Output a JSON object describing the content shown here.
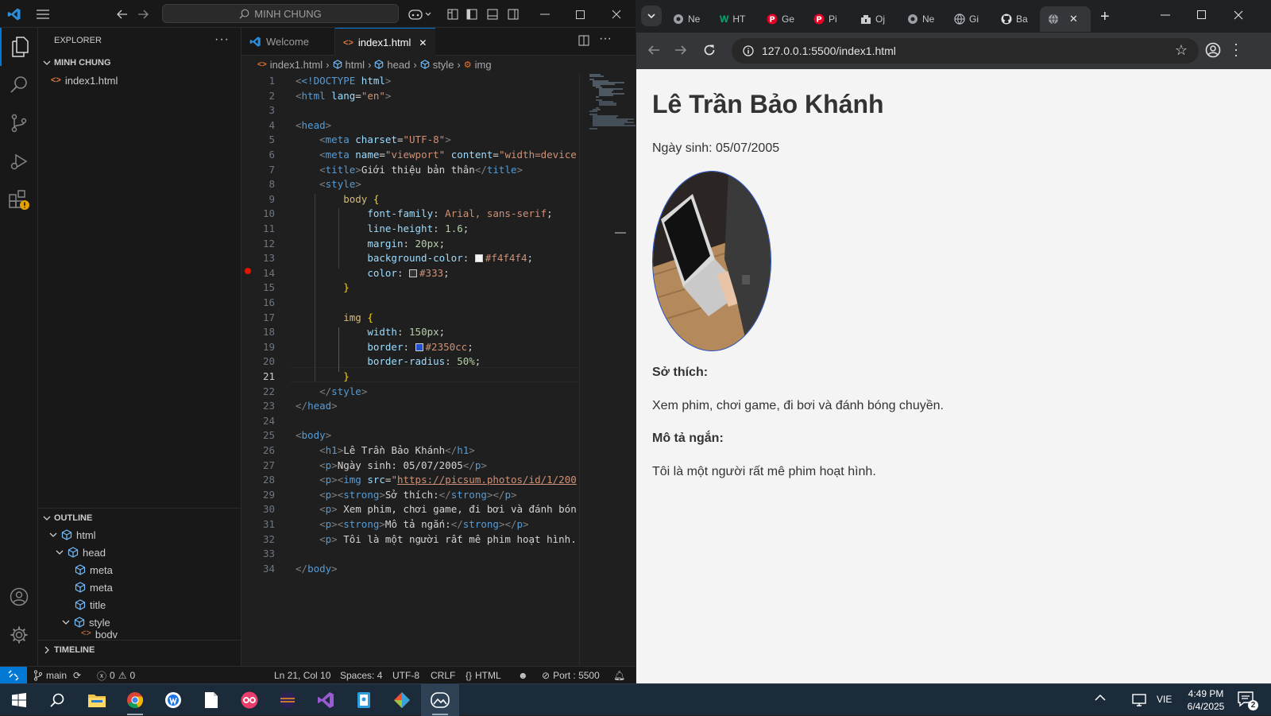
{
  "vscode": {
    "search_text": "MINH CHUNG",
    "explorer_title": "EXPLORER",
    "folder_name": "MINH CHUNG",
    "file_name": "index1.html",
    "outline_title": "OUTLINE",
    "outline_items": [
      "html",
      "head",
      "meta",
      "meta",
      "title",
      "style",
      "body"
    ],
    "timeline_title": "TIMELINE",
    "tabs": [
      {
        "label": "Welcome"
      },
      {
        "label": "index1.html",
        "close": "✕"
      }
    ],
    "breadcrumb": [
      "index1.html",
      "html",
      "head",
      "style",
      "img"
    ],
    "line_numbers": [
      "1",
      "2",
      "3",
      "4",
      "5",
      "6",
      "7",
      "8",
      "9",
      "10",
      "11",
      "12",
      "13",
      "14",
      "15",
      "16",
      "17",
      "18",
      "19",
      "20",
      "21",
      "22",
      "23",
      "24",
      "25",
      "26",
      "27",
      "28",
      "29",
      "30",
      "31",
      "32",
      "33",
      "34"
    ],
    "code": {
      "l1a": "<!DOCTYPE",
      "l1b": " html",
      "l2t": "html",
      "l2a": "lang",
      "l2v": "\"en\"",
      "l4t": "head",
      "l5t": "meta",
      "l5a": "charset",
      "l5v": "\"UTF-8\"",
      "l6t": "meta",
      "l6a": "name",
      "l6v": "\"viewport\"",
      "l6a2": "content",
      "l6v2": "\"width=device",
      "l7t": "title",
      "l7x": "Giới thiệu bản thân",
      "l8t": "style",
      "l9s": "body",
      "l10p": "font-family",
      "l10v": "Arial, sans-serif",
      "l11p": "line-height",
      "l11v": "1.6",
      "l12p": "margin",
      "l12v": "20px",
      "l13p": "background-color",
      "l13v": "#f4f4f4",
      "l14p": "color",
      "l14v": "#333",
      "l17s": "img",
      "l18p": "width",
      "l18v": "150px",
      "l19p": "border",
      "l19v": "#2350cc",
      "l20p": "border-radius",
      "l20v": "50%",
      "l22t": "style",
      "l23t": "head",
      "l25t": "body",
      "l26t": "h1",
      "l26x": "Lê Trần Bảo Khánh",
      "l27t": "p",
      "l27x": "Ngày sinh: 05/07/2005",
      "l28t": "p",
      "l28t2": "img",
      "l28a": "src",
      "l28v": "https://picsum.photos/id/1/200",
      "l29t": "p",
      "l29t2": "strong",
      "l29x": "Sở thích:",
      "l30t": "p",
      "l30x": " Xem phim, chơi game, đi bơi và đánh bón",
      "l31t": "p",
      "l31t2": "strong",
      "l31x": "Mô tả ngắn:",
      "l32t": "p",
      "l32x": " Tôi là một người rất mê phim hoạt hình.",
      "l34t": "body"
    },
    "status": {
      "branch": "main",
      "problems": "0",
      "warnings": "0",
      "position": "Ln 21, Col 10",
      "spaces": "Spaces: 4",
      "encoding": "UTF-8",
      "eol": "CRLF",
      "language": "HTML",
      "port": "Port : 5500"
    }
  },
  "chrome": {
    "tabs": [
      {
        "label": "Ne",
        "icon": "chrome-icon"
      },
      {
        "label": "HT",
        "icon": "w3schools-icon"
      },
      {
        "label": "Ge",
        "icon": "pinterest-icon"
      },
      {
        "label": "Pi",
        "icon": "pinterest-icon"
      },
      {
        "label": "Oj",
        "icon": "oj-icon"
      },
      {
        "label": "Ne",
        "icon": "chrome-icon"
      },
      {
        "label": "Gi",
        "icon": "globe-icon"
      },
      {
        "label": "Ba",
        "icon": "github-icon"
      }
    ],
    "url": "127.0.0.1:5500/index1.html",
    "page": {
      "heading": "Lê Trần Bảo Khánh",
      "dob": "Ngày sinh: 05/07/2005",
      "hobby_label": "Sở thích:",
      "hobby_text": "Xem phim, chơi game, đi bơi và đánh bóng chuyền.",
      "desc_label": "Mô tả ngắn:",
      "desc_text": "Tôi là một người rất mê phim hoạt hình."
    }
  },
  "taskbar": {
    "language": "VIE",
    "time": "4:49 PM",
    "date": "6/4/2025",
    "notifications": "2"
  }
}
